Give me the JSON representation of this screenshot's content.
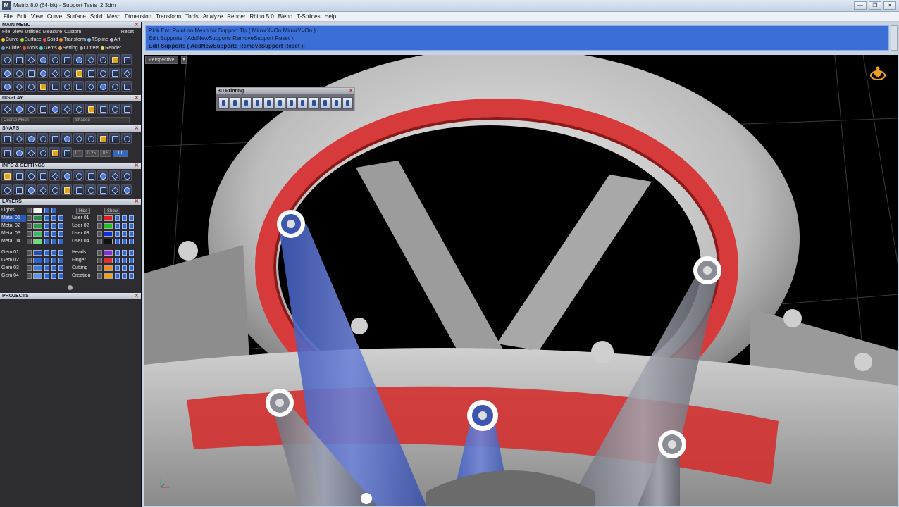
{
  "window": {
    "title": "Matrix 8.0 (64-bit) - Support Tests_2.3dm",
    "minimize": "—",
    "maximize": "❐",
    "close": "✕"
  },
  "menubar": [
    "File",
    "Edit",
    "View",
    "Curve",
    "Surface",
    "Solid",
    "Mesh",
    "Dimension",
    "Transform",
    "Tools",
    "Analyze",
    "Render",
    "Rhino 5.0",
    "Blend",
    "T-Splines",
    "Help"
  ],
  "main_menu": {
    "header": "MAIN MENU",
    "submenu": [
      "File",
      "View",
      "Utilities",
      "Measure",
      "Custom"
    ],
    "reset": "Reset",
    "categories_row1": [
      {
        "label": "Curve",
        "color": "#e6c229"
      },
      {
        "label": "Surface",
        "color": "#9ad04a"
      },
      {
        "label": "Solid",
        "color": "#e05050"
      },
      {
        "label": "Transform",
        "color": "#f08a30"
      },
      {
        "label": "TSpline",
        "color": "#7cc0f0"
      },
      {
        "label": "Art",
        "color": "#d0a0e0"
      }
    ],
    "categories_row2": [
      {
        "label": "Builder",
        "color": "#6a9ae0"
      },
      {
        "label": "Tools",
        "color": "#e05a5a"
      },
      {
        "label": "Gems",
        "color": "#50d0d0"
      },
      {
        "label": "Setting",
        "color": "#f0a050"
      },
      {
        "label": "Cutters",
        "color": "#a0a0a0"
      },
      {
        "label": "Render",
        "color": "#e0e060"
      }
    ]
  },
  "display": {
    "header": "DISPLAY",
    "mesh_select": "Coarse Mesh",
    "shade_select": "Shaded"
  },
  "snaps": {
    "header": "SNAPS",
    "values": [
      "0.1",
      "0.25",
      "0.5",
      "1.0"
    ]
  },
  "info_settings": {
    "header": "INFO & SETTINGS"
  },
  "layers": {
    "header": "LAYERS",
    "lights": "Lights",
    "hide": "Hide",
    "show": "Show",
    "left": [
      {
        "name": "Metal 01",
        "color": "#2e8b57",
        "selected": true
      },
      {
        "name": "Metal 02",
        "color": "#2e9b4e",
        "selected": false
      },
      {
        "name": "Metal 03",
        "color": "#3bb86a",
        "selected": false
      },
      {
        "name": "Metal 04",
        "color": "#6edb7a",
        "selected": false
      },
      {
        "name": "Gem 01",
        "color": "#1f4fb8",
        "selected": false
      },
      {
        "name": "Gem 02",
        "color": "#2a62d0",
        "selected": false
      },
      {
        "name": "Gem 03",
        "color": "#3a78e6",
        "selected": false
      },
      {
        "name": "Gem 04",
        "color": "#5b95f0",
        "selected": false
      }
    ],
    "right": [
      {
        "name": "User 01",
        "color": "#e02020"
      },
      {
        "name": "User 02",
        "color": "#20c020"
      },
      {
        "name": "User 03",
        "color": "#1030e0"
      },
      {
        "name": "User 04",
        "color": "#101010"
      },
      {
        "name": "Heads",
        "color": "#8a2be2"
      },
      {
        "name": "Finger",
        "color": "#e03030"
      },
      {
        "name": "Cutting",
        "color": "#f08a20"
      },
      {
        "name": "Creation",
        "color": "#f0a020"
      }
    ]
  },
  "projects": {
    "header": "PROJECTS"
  },
  "command": {
    "line1": "Pick End Point on Mesh for Support Tip ( MirrorX=On  MirrorY=On ):",
    "line2": "Edit Supports ( AddNewSupports  RemoveSupport  Reset ):",
    "line3": "Edit Supports ( AddNewSupports  RemoveSupport  Reset ):"
  },
  "viewport": {
    "label": "Perspective"
  },
  "floating_toolbar": {
    "title": "3D Printing"
  }
}
